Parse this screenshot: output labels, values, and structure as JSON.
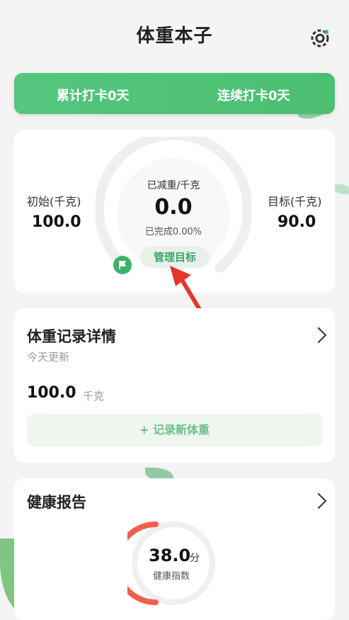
{
  "header": {
    "title": "体重本子",
    "settings_icon": "gear-icon"
  },
  "streak": {
    "cumulative": "累计打卡0天",
    "consecutive": "连续打卡0天"
  },
  "goal": {
    "initial_label": "初始(千克)",
    "initial_value": "100.0",
    "target_label": "目标(千克)",
    "target_value": "90.0",
    "lost_label": "已减重/千克",
    "lost_value": "0.0",
    "completion": "已完成0.00%",
    "completion_fraction": 0.0,
    "manage_button": "管理目标"
  },
  "record": {
    "title": "体重记录详情",
    "updated": "今天更新",
    "weight_value": "100.0",
    "weight_unit": "千克",
    "add_button": "+ 记录新体重"
  },
  "health": {
    "title": "健康报告",
    "score": "38.0",
    "score_unit": "分",
    "score_label": "健康指数"
  },
  "colors": {
    "brand_green": "#4cbf72",
    "accent_red": "#f0604d"
  }
}
